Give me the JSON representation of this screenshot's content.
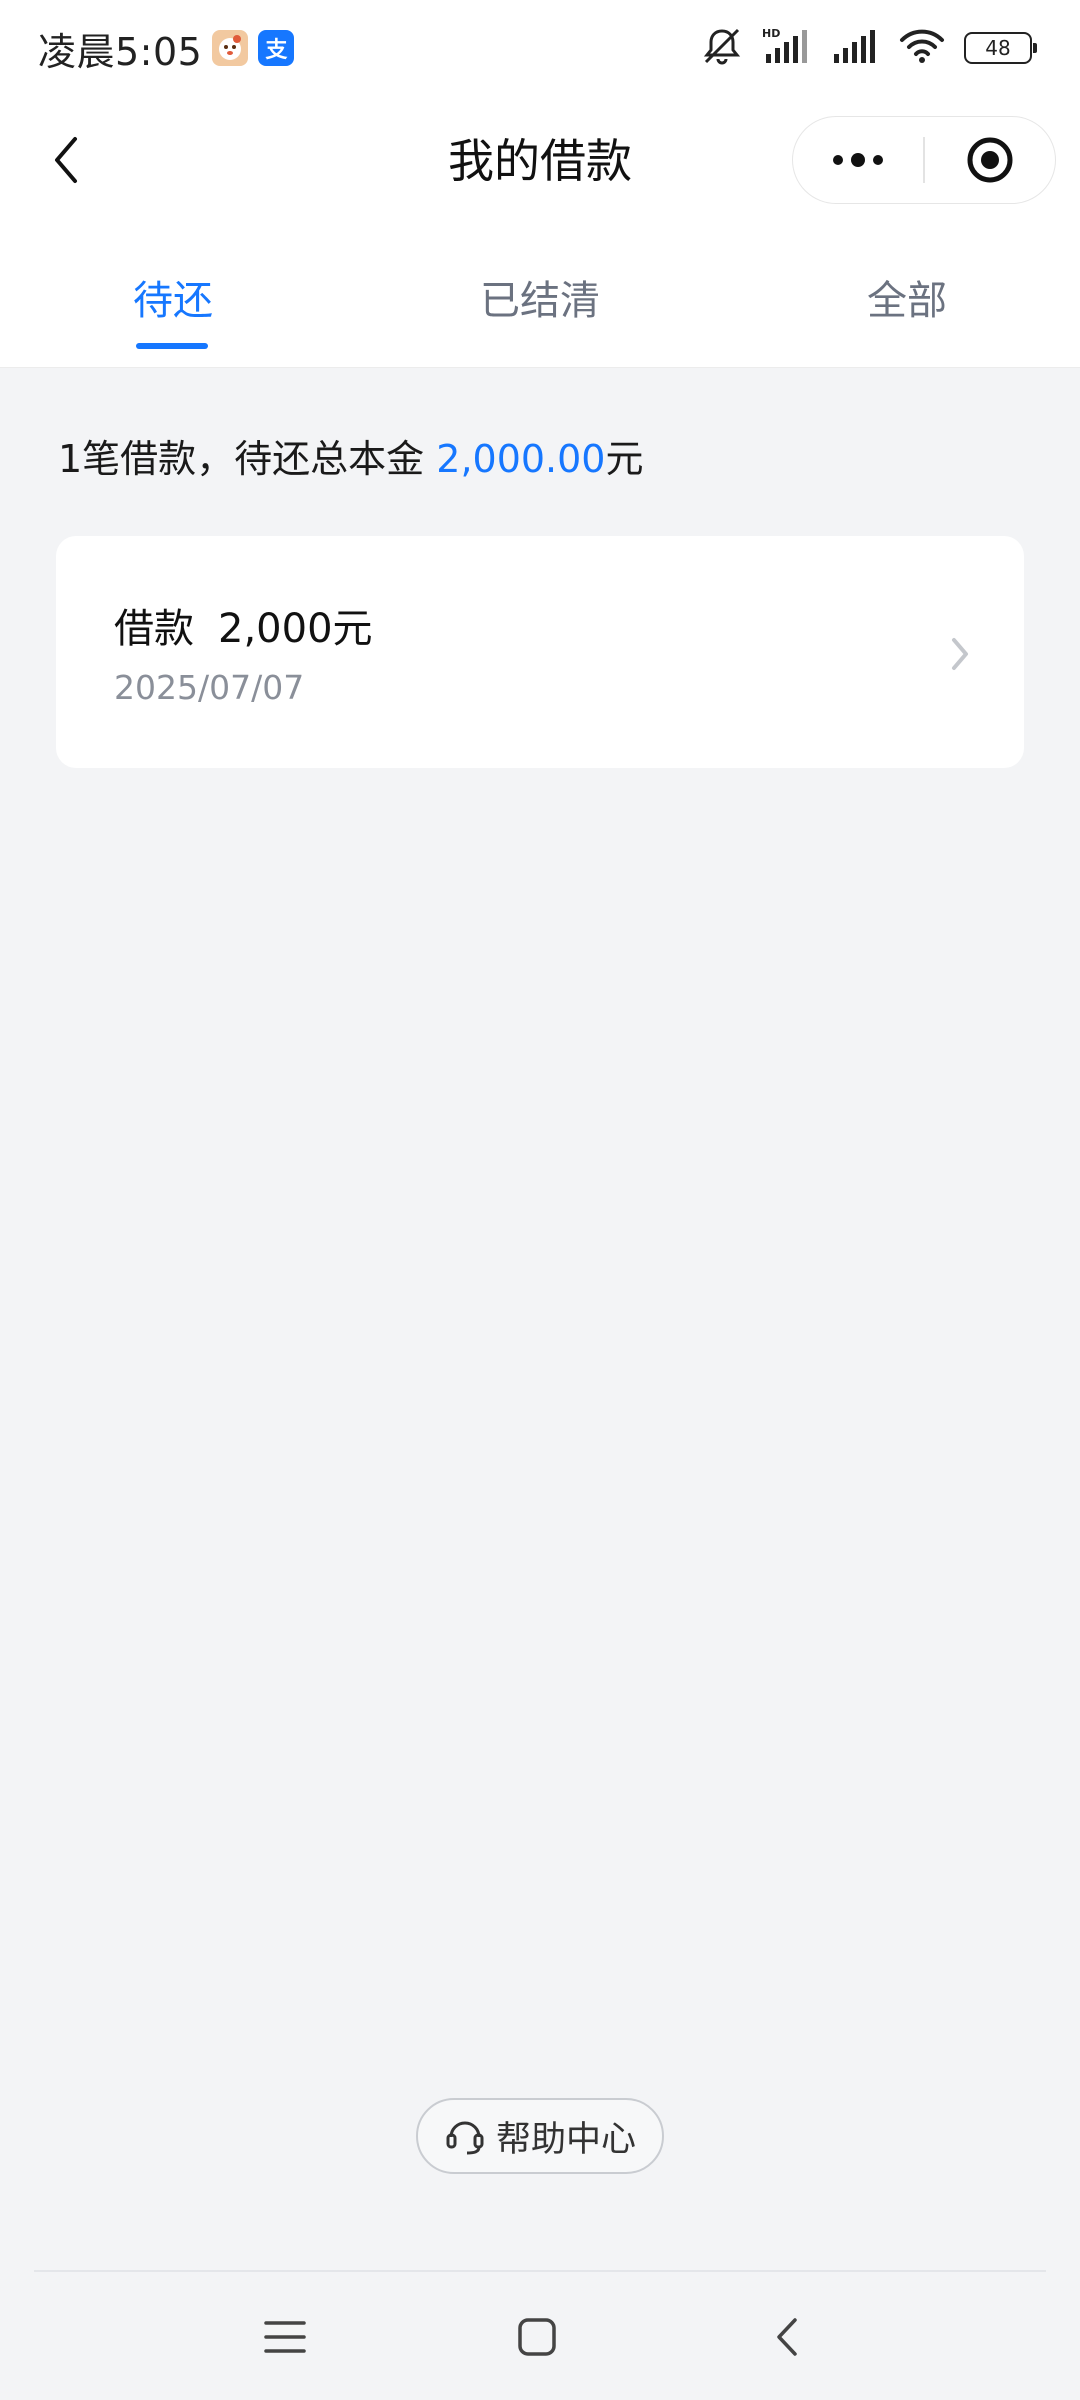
{
  "status_bar": {
    "time": "凌晨5:05",
    "app_icon_2_glyph": "支",
    "battery": "48"
  },
  "nav": {
    "title": "我的借款"
  },
  "tabs": [
    {
      "label": "待还",
      "active": true
    },
    {
      "label": "已结清",
      "active": false
    },
    {
      "label": "全部",
      "active": false
    }
  ],
  "summary": {
    "prefix": "1笔借款，待还总本金 ",
    "amount": "2,000.00",
    "suffix": "元"
  },
  "loans": [
    {
      "label": "借款",
      "amount": "2,000元",
      "date": "2025/07/07"
    }
  ],
  "help": {
    "label": "帮助中心"
  },
  "colors": {
    "accent": "#1677ff",
    "background": "#f3f4f6"
  }
}
